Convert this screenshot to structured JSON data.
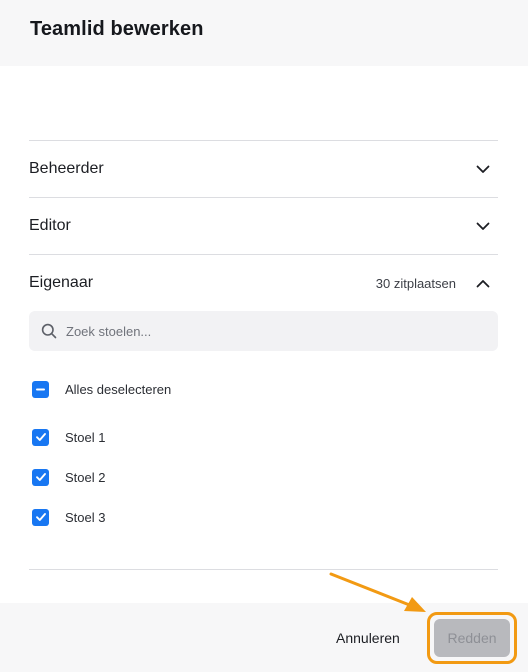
{
  "dialog": {
    "title": "Teamlid bewerken"
  },
  "roles": [
    {
      "label": "Beheerder",
      "expanded": false
    },
    {
      "label": "Editor",
      "expanded": false
    },
    {
      "label": "Eigenaar",
      "expanded": true,
      "seat_count": "30 zitplaatsen"
    }
  ],
  "search": {
    "placeholder": "Zoek stoelen...",
    "value": ""
  },
  "select_all": {
    "label": "Alles deselecteren",
    "state": "indeterminate"
  },
  "seats": [
    {
      "label": "Stoel 1",
      "checked": true
    },
    {
      "label": "Stoel 2",
      "checked": true
    },
    {
      "label": "Stoel 3",
      "checked": true
    }
  ],
  "footer": {
    "cancel_label": "Annuleren",
    "save_label": "Redden",
    "save_disabled": true
  },
  "colors": {
    "accent": "#1877f2",
    "highlight": "#f29a13",
    "disabled_button": "#b8b9bd"
  },
  "icons": {
    "search": "search-icon",
    "expand": "chevron-down-icon",
    "collapse": "chevron-up-icon",
    "check": "check-icon",
    "indeterminate": "minus-icon",
    "pointer": "arrow-pointer-icon"
  }
}
